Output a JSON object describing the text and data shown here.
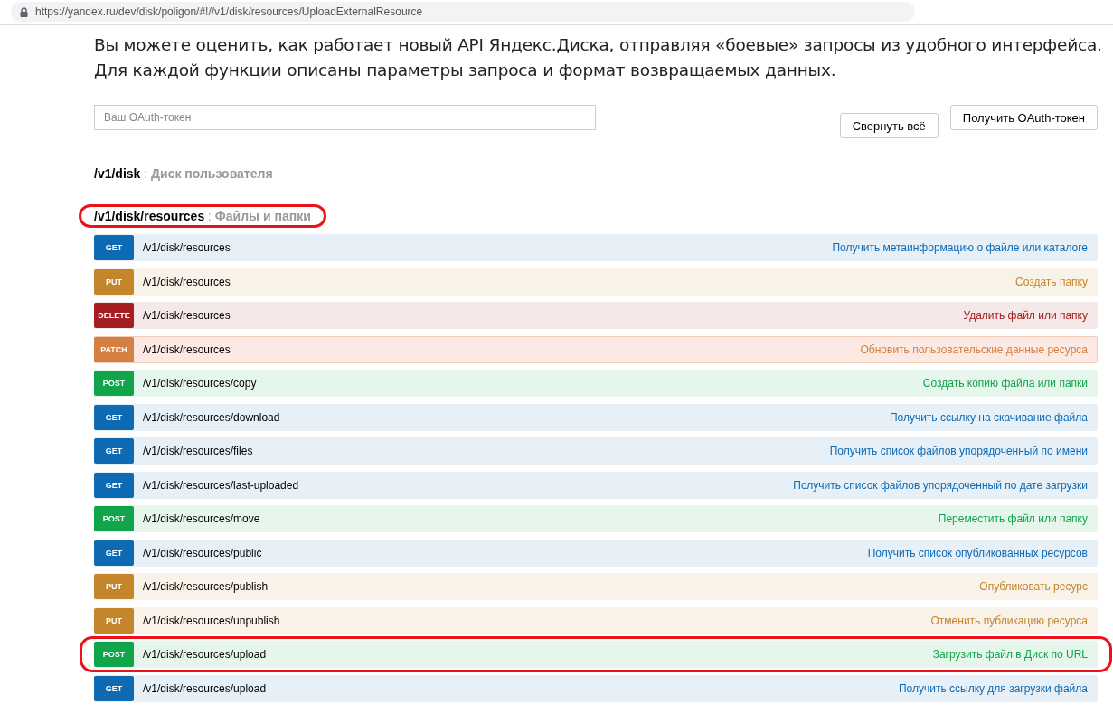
{
  "address_bar": {
    "url": "https://yandex.ru/dev/disk/poligon/#!//v1/disk/resources/UploadExternalResource"
  },
  "intro": "Вы можете оценить, как работает новый API Яндекс.Диска, отправляя «боевые» запросы из удобного интерфейса. Для каждой функции описаны параметры запроса и формат возвращаемых данных.",
  "token_field": {
    "placeholder": "Ваш OAuth-токен"
  },
  "buttons": [
    "Свернуть всё",
    "Получить OAuth-токен"
  ],
  "sections": [
    {
      "path": "/v1/disk",
      "separator": ":",
      "description": "Диск пользователя",
      "highlighted": false
    },
    {
      "path": "/v1/disk/resources",
      "separator": ":",
      "description": "Файлы и папки",
      "highlighted": true,
      "endpoints": [
        {
          "method": "GET",
          "path": "/v1/disk/resources",
          "summary": "Получить метаинформацию о файле или каталоге",
          "highlighted": false
        },
        {
          "method": "PUT",
          "path": "/v1/disk/resources",
          "summary": "Создать папку",
          "highlighted": false
        },
        {
          "method": "DELETE",
          "path": "/v1/disk/resources",
          "summary": "Удалить файл или папку",
          "highlighted": false
        },
        {
          "method": "PATCH",
          "path": "/v1/disk/resources",
          "summary": "Обновить пользовательские данные ресурса",
          "highlighted": false
        },
        {
          "method": "POST",
          "path": "/v1/disk/resources/copy",
          "summary": "Создать копию файла или папки",
          "highlighted": false
        },
        {
          "method": "GET",
          "path": "/v1/disk/resources/download",
          "summary": "Получить ссылку на скачивание файла",
          "highlighted": false
        },
        {
          "method": "GET",
          "path": "/v1/disk/resources/files",
          "summary": "Получить список файлов упорядоченный по имени",
          "highlighted": false
        },
        {
          "method": "GET",
          "path": "/v1/disk/resources/last-uploaded",
          "summary": "Получить список файлов упорядоченный по дате загрузки",
          "highlighted": false
        },
        {
          "method": "POST",
          "path": "/v1/disk/resources/move",
          "summary": "Переместить файл или папку",
          "highlighted": false
        },
        {
          "method": "GET",
          "path": "/v1/disk/resources/public",
          "summary": "Получить список опубликованных ресурсов",
          "highlighted": false
        },
        {
          "method": "PUT",
          "path": "/v1/disk/resources/publish",
          "summary": "Опубликовать ресурс",
          "highlighted": false
        },
        {
          "method": "PUT",
          "path": "/v1/disk/resources/unpublish",
          "summary": "Отменить публикацию ресурса",
          "highlighted": false
        },
        {
          "method": "POST",
          "path": "/v1/disk/resources/upload",
          "summary": "Загрузить файл в Диск по URL",
          "highlighted": true
        },
        {
          "method": "GET",
          "path": "/v1/disk/resources/upload",
          "summary": "Получить ссылку для загрузки файла",
          "highlighted": false
        }
      ]
    }
  ]
}
